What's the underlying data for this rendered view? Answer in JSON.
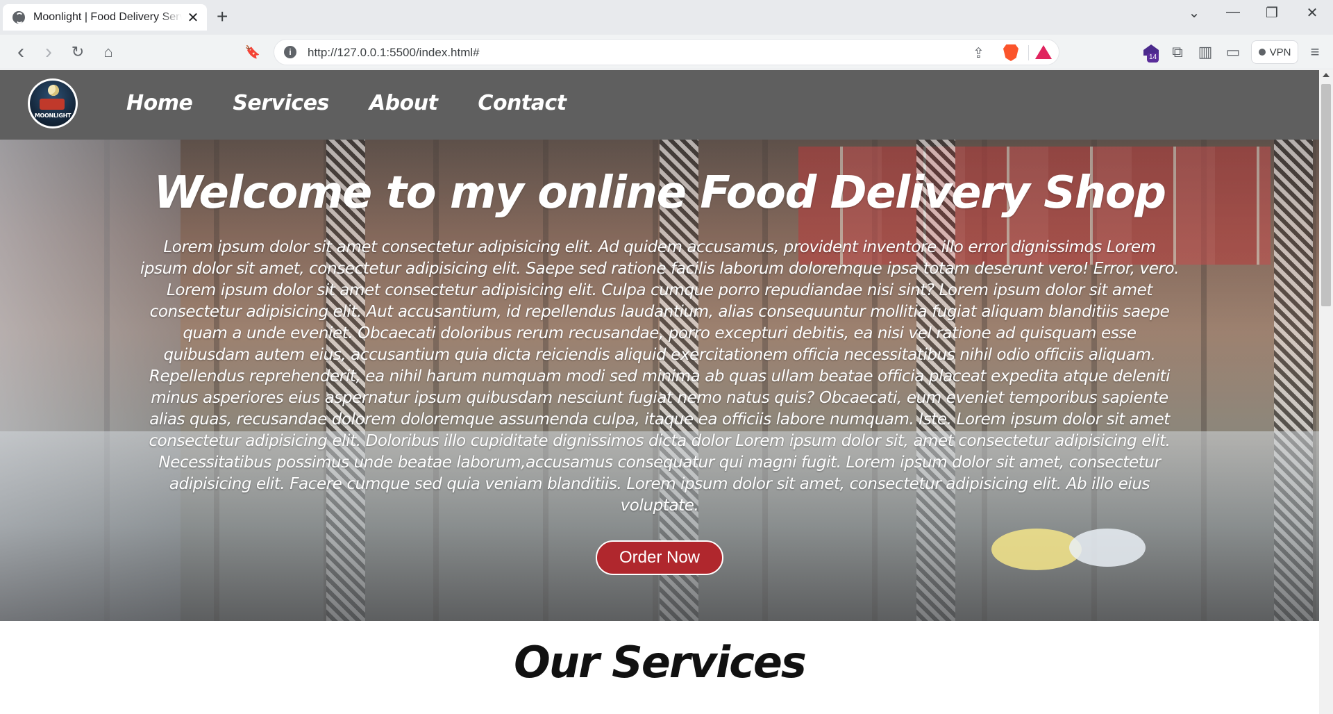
{
  "browser": {
    "tab_title": "Moonlight | Food Delivery Services",
    "tab_close": "✕",
    "new_tab": "+",
    "url": "http://127.0.0.1:5500/index.html#",
    "vpn_label": "VPN",
    "extension_badge": "14",
    "window_controls": {
      "dropdown": "⌄",
      "minimize": "—",
      "restore": "❐",
      "close": "✕"
    },
    "nav_icons": {
      "back": "‹",
      "forward": "›",
      "reload": "↻",
      "home": "⌂",
      "bookmark": "🔖",
      "info": "i",
      "share": "⇪",
      "puzzle": "⧉",
      "sidebar": "▥",
      "wallet": "▭",
      "menu": "≡"
    }
  },
  "site": {
    "logo_text": "MOONLIGHT",
    "nav": [
      "Home",
      "Services",
      "About",
      "Contact"
    ],
    "hero": {
      "title": "Welcome to my online Food Delivery Shop",
      "paragraph": "Lorem ipsum dolor sit amet consectetur adipisicing elit. Ad quidem accusamus, provident inventore illo error dignissimos Lorem ipsum dolor sit amet, consectetur adipisicing elit. Saepe sed ratione facilis laborum doloremque ipsa totam deserunt vero! Error, vero. Lorem ipsum dolor sit amet consectetur adipisicing elit. Culpa cumque porro repudiandae nisi sint? Lorem ipsum dolor sit amet consectetur adipisicing elit. Aut accusantium, id repellendus laudantium, alias consequuntur mollitia fugiat aliquam blanditiis saepe quam a unde eveniet. Obcaecati doloribus rerum recusandae, porro excepturi debitis, ea nisi vel ratione ad quisquam esse quibusdam autem eius, accusantium quia dicta reiciendis aliquid exercitationem officia necessitatibus nihil odio officiis aliquam. Repellendus reprehenderit, ea nihil harum numquam modi sed minima ab quas ullam beatae officia placeat expedita atque deleniti minus asperiores eius aspernatur ipsum quibusdam nesciunt fugiat nemo natus quis? Obcaecati, eum eveniet temporibus sapiente alias quas, recusandae dolorem doloremque assumenda culpa, itaque ea officiis labore numquam. Iste. Lorem ipsum dolor sit amet consectetur adipisicing elit. Doloribus illo cupiditate dignissimos dicta dolor Lorem ipsum dolor sit, amet consectetur adipisicing elit. Necessitatibus possimus unde beatae laborum,accusamus consequatur qui magni fugit. Lorem ipsum dolor sit amet, consectetur adipisicing elit. Facere cumque sed quia veniam blanditiis. Lorem ipsum dolor sit amet, consectetur adipisicing elit. Ab illo eius voluptate.",
      "cta": "Order Now"
    },
    "services_title": "Our Services"
  },
  "colors": {
    "nav_bg": "#5f5f5f",
    "cta_bg": "#b0272d",
    "brave_orange": "#fb542b"
  }
}
